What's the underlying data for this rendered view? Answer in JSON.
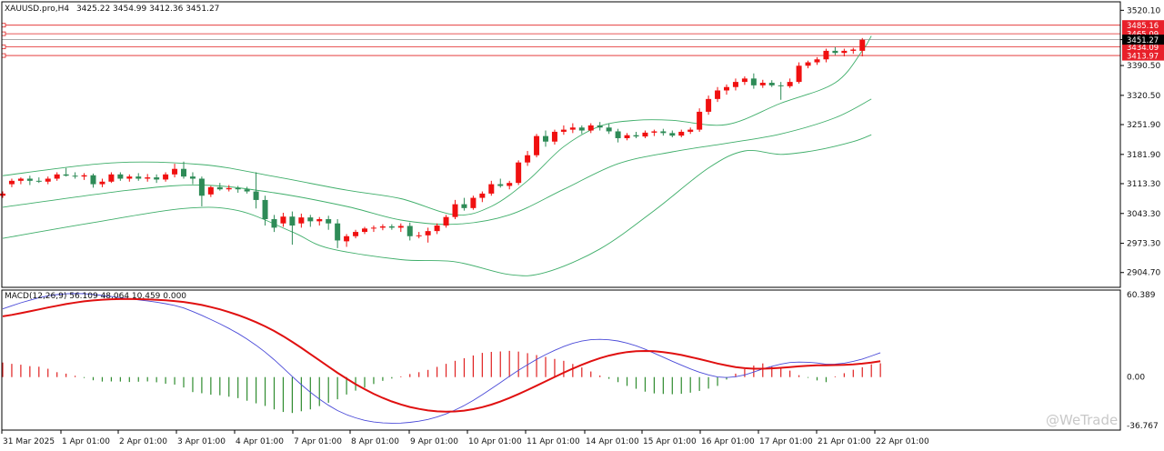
{
  "chart_data": {
    "type": "candlestick",
    "header": {
      "symbol_label": "XAUUSD.pro,H4",
      "ohlc": "3425.22 3454.99 3412.36 3451.27"
    },
    "price_axis": {
      "range": [
        2870,
        3540
      ],
      "ticks": [
        "3520.10",
        "3451.27",
        "3390.50",
        "3320.50",
        "3251.90",
        "3181.90",
        "3113.30",
        "3043.30",
        "2973.30",
        "2904.70"
      ]
    },
    "level_lines": [
      {
        "value": 3485.16,
        "label": "3485.16"
      },
      {
        "value": 3465.09,
        "label": "3465.09"
      },
      {
        "value": 3434.09,
        "label": "3434.09"
      },
      {
        "value": 3413.97,
        "label": "3413.97"
      }
    ],
    "current_price": {
      "value": 3451.27,
      "label": "3451.27"
    },
    "x_axis_labels": [
      "31 Mar 2025",
      "1 Apr 01:00",
      "2 Apr 01:00",
      "3 Apr 01:00",
      "4 Apr 01:00",
      "7 Apr 01:00",
      "8 Apr 01:00",
      "9 Apr 01:00",
      "10 Apr 01:00",
      "11 Apr 01:00",
      "14 Apr 01:00",
      "15 Apr 01:00",
      "16 Apr 01:00",
      "17 Apr 01:00",
      "21 Apr 01:00",
      "22 Apr 01:00"
    ],
    "candles": [
      {
        "o": 3085,
        "h": 3095,
        "l": 3080,
        "c": 3090
      },
      {
        "o": 3112,
        "h": 3125,
        "l": 3105,
        "c": 3120
      },
      {
        "o": 3120,
        "h": 3128,
        "l": 3112,
        "c": 3125
      },
      {
        "o": 3125,
        "h": 3132,
        "l": 3110,
        "c": 3120
      },
      {
        "o": 3120,
        "h": 3128,
        "l": 3115,
        "c": 3118
      },
      {
        "o": 3118,
        "h": 3130,
        "l": 3112,
        "c": 3125
      },
      {
        "o": 3125,
        "h": 3140,
        "l": 3120,
        "c": 3135
      },
      {
        "o": 3135,
        "h": 3150,
        "l": 3130,
        "c": 3132
      },
      {
        "o": 3132,
        "h": 3140,
        "l": 3125,
        "c": 3130
      },
      {
        "o": 3130,
        "h": 3138,
        "l": 3122,
        "c": 3133
      },
      {
        "o": 3133,
        "h": 3137,
        "l": 3104,
        "c": 3112
      },
      {
        "o": 3112,
        "h": 3125,
        "l": 3105,
        "c": 3118
      },
      {
        "o": 3118,
        "h": 3140,
        "l": 3115,
        "c": 3135
      },
      {
        "o": 3135,
        "h": 3140,
        "l": 3120,
        "c": 3125
      },
      {
        "o": 3125,
        "h": 3135,
        "l": 3118,
        "c": 3130
      },
      {
        "o": 3130,
        "h": 3138,
        "l": 3120,
        "c": 3125
      },
      {
        "o": 3125,
        "h": 3136,
        "l": 3118,
        "c": 3128
      },
      {
        "o": 3128,
        "h": 3135,
        "l": 3115,
        "c": 3123
      },
      {
        "o": 3123,
        "h": 3140,
        "l": 3118,
        "c": 3135
      },
      {
        "o": 3135,
        "h": 3160,
        "l": 3128,
        "c": 3148
      },
      {
        "o": 3148,
        "h": 3165,
        "l": 3125,
        "c": 3130
      },
      {
        "o": 3130,
        "h": 3140,
        "l": 3112,
        "c": 3125
      },
      {
        "o": 3125,
        "h": 3130,
        "l": 3060,
        "c": 3085
      },
      {
        "o": 3088,
        "h": 3108,
        "l": 3082,
        "c": 3105
      },
      {
        "o": 3105,
        "h": 3115,
        "l": 3097,
        "c": 3100
      },
      {
        "o": 3100,
        "h": 3110,
        "l": 3095,
        "c": 3103
      },
      {
        "o": 3103,
        "h": 3108,
        "l": 3092,
        "c": 3100
      },
      {
        "o": 3100,
        "h": 3106,
        "l": 3090,
        "c": 3095
      },
      {
        "o": 3095,
        "h": 3140,
        "l": 3055,
        "c": 3075
      },
      {
        "o": 3075,
        "h": 3085,
        "l": 3015,
        "c": 3030
      },
      {
        "o": 3030,
        "h": 3040,
        "l": 3000,
        "c": 3010
      },
      {
        "o": 3020,
        "h": 3045,
        "l": 3012,
        "c": 3036
      },
      {
        "o": 3036,
        "h": 3048,
        "l": 2970,
        "c": 3015
      },
      {
        "o": 3020,
        "h": 3043,
        "l": 3010,
        "c": 3034
      },
      {
        "o": 3034,
        "h": 3040,
        "l": 3012,
        "c": 3025
      },
      {
        "o": 3025,
        "h": 3035,
        "l": 3015,
        "c": 3030
      },
      {
        "o": 3030,
        "h": 3038,
        "l": 3005,
        "c": 3020
      },
      {
        "o": 3020,
        "h": 3030,
        "l": 2962,
        "c": 2980
      },
      {
        "o": 2978,
        "h": 2995,
        "l": 2965,
        "c": 2990
      },
      {
        "o": 2990,
        "h": 3005,
        "l": 2985,
        "c": 3000
      },
      {
        "o": 3000,
        "h": 3012,
        "l": 2995,
        "c": 3008
      },
      {
        "o": 3008,
        "h": 3015,
        "l": 3000,
        "c": 3010
      },
      {
        "o": 3010,
        "h": 3018,
        "l": 3004,
        "c": 3013
      },
      {
        "o": 3013,
        "h": 3018,
        "l": 3005,
        "c": 3010
      },
      {
        "o": 3010,
        "h": 3020,
        "l": 3000,
        "c": 3014
      },
      {
        "o": 3014,
        "h": 3022,
        "l": 2980,
        "c": 2990
      },
      {
        "o": 2990,
        "h": 3000,
        "l": 2985,
        "c": 2992
      },
      {
        "o": 2992,
        "h": 3010,
        "l": 2975,
        "c": 3002
      },
      {
        "o": 3002,
        "h": 3020,
        "l": 2995,
        "c": 3015
      },
      {
        "o": 3015,
        "h": 3040,
        "l": 3010,
        "c": 3035
      },
      {
        "o": 3035,
        "h": 3075,
        "l": 3030,
        "c": 3065
      },
      {
        "o": 3065,
        "h": 3080,
        "l": 3050,
        "c": 3056
      },
      {
        "o": 3056,
        "h": 3085,
        "l": 3052,
        "c": 3080
      },
      {
        "o": 3080,
        "h": 3095,
        "l": 3070,
        "c": 3090
      },
      {
        "o": 3090,
        "h": 3120,
        "l": 3085,
        "c": 3112
      },
      {
        "o": 3112,
        "h": 3125,
        "l": 3104,
        "c": 3108
      },
      {
        "o": 3108,
        "h": 3120,
        "l": 3100,
        "c": 3115
      },
      {
        "o": 3115,
        "h": 3168,
        "l": 3110,
        "c": 3163
      },
      {
        "o": 3163,
        "h": 3190,
        "l": 3155,
        "c": 3180
      },
      {
        "o": 3180,
        "h": 3230,
        "l": 3175,
        "c": 3225
      },
      {
        "o": 3225,
        "h": 3238,
        "l": 3200,
        "c": 3212
      },
      {
        "o": 3212,
        "h": 3240,
        "l": 3205,
        "c": 3235
      },
      {
        "o": 3235,
        "h": 3250,
        "l": 3228,
        "c": 3240
      },
      {
        "o": 3240,
        "h": 3255,
        "l": 3232,
        "c": 3245
      },
      {
        "o": 3245,
        "h": 3250,
        "l": 3230,
        "c": 3238
      },
      {
        "o": 3238,
        "h": 3255,
        "l": 3232,
        "c": 3250
      },
      {
        "o": 3250,
        "h": 3258,
        "l": 3238,
        "c": 3245
      },
      {
        "o": 3245,
        "h": 3255,
        "l": 3230,
        "c": 3236
      },
      {
        "o": 3236,
        "h": 3242,
        "l": 3210,
        "c": 3220
      },
      {
        "o": 3220,
        "h": 3232,
        "l": 3215,
        "c": 3227
      },
      {
        "o": 3227,
        "h": 3235,
        "l": 3220,
        "c": 3224
      },
      {
        "o": 3224,
        "h": 3238,
        "l": 3220,
        "c": 3233
      },
      {
        "o": 3233,
        "h": 3240,
        "l": 3225,
        "c": 3236
      },
      {
        "o": 3236,
        "h": 3242,
        "l": 3226,
        "c": 3232
      },
      {
        "o": 3232,
        "h": 3238,
        "l": 3222,
        "c": 3226
      },
      {
        "o": 3226,
        "h": 3240,
        "l": 3222,
        "c": 3235
      },
      {
        "o": 3235,
        "h": 3245,
        "l": 3230,
        "c": 3240
      },
      {
        "o": 3240,
        "h": 3290,
        "l": 3235,
        "c": 3282
      },
      {
        "o": 3282,
        "h": 3320,
        "l": 3275,
        "c": 3312
      },
      {
        "o": 3312,
        "h": 3340,
        "l": 3305,
        "c": 3332
      },
      {
        "o": 3332,
        "h": 3346,
        "l": 3322,
        "c": 3340
      },
      {
        "o": 3340,
        "h": 3360,
        "l": 3332,
        "c": 3352
      },
      {
        "o": 3352,
        "h": 3365,
        "l": 3345,
        "c": 3360
      },
      {
        "o": 3360,
        "h": 3372,
        "l": 3336,
        "c": 3344
      },
      {
        "o": 3344,
        "h": 3357,
        "l": 3338,
        "c": 3350
      },
      {
        "o": 3350,
        "h": 3356,
        "l": 3340,
        "c": 3344
      },
      {
        "o": 3344,
        "h": 3352,
        "l": 3310,
        "c": 3342
      },
      {
        "o": 3342,
        "h": 3360,
        "l": 3338,
        "c": 3352
      },
      {
        "o": 3352,
        "h": 3398,
        "l": 3348,
        "c": 3390
      },
      {
        "o": 3390,
        "h": 3402,
        "l": 3384,
        "c": 3398
      },
      {
        "o": 3398,
        "h": 3410,
        "l": 3392,
        "c": 3405
      },
      {
        "o": 3405,
        "h": 3430,
        "l": 3398,
        "c": 3425
      },
      {
        "o": 3425,
        "h": 3434,
        "l": 3415,
        "c": 3420
      },
      {
        "o": 3420,
        "h": 3430,
        "l": 3412,
        "c": 3425
      },
      {
        "o": 3425,
        "h": 3432,
        "l": 3418,
        "c": 3428
      },
      {
        "o": 3425,
        "h": 3455,
        "l": 3412,
        "c": 3451
      }
    ],
    "bollinger_bands": {
      "upper": [
        [
          0,
          3132
        ],
        [
          12,
          3162
        ],
        [
          22,
          3158
        ],
        [
          30,
          3130
        ],
        [
          38,
          3098
        ],
        [
          44,
          3078
        ],
        [
          50,
          3040
        ],
        [
          54,
          3060
        ],
        [
          58,
          3120
        ],
        [
          62,
          3200
        ],
        [
          66,
          3248
        ],
        [
          70,
          3262
        ],
        [
          74,
          3262
        ],
        [
          80,
          3252
        ],
        [
          86,
          3302
        ],
        [
          92,
          3350
        ],
        [
          95,
          3425
        ],
        [
          96,
          3460
        ]
      ],
      "middle": [
        [
          0,
          3058
        ],
        [
          14,
          3098
        ],
        [
          22,
          3110
        ],
        [
          30,
          3092
        ],
        [
          38,
          3060
        ],
        [
          44,
          3028
        ],
        [
          50,
          3018
        ],
        [
          56,
          3040
        ],
        [
          62,
          3100
        ],
        [
          68,
          3160
        ],
        [
          74,
          3188
        ],
        [
          80,
          3208
        ],
        [
          86,
          3230
        ],
        [
          92,
          3268
        ],
        [
          96,
          3312
        ]
      ],
      "lower": [
        [
          0,
          2985
        ],
        [
          10,
          3022
        ],
        [
          20,
          3055
        ],
        [
          26,
          3050
        ],
        [
          32,
          3000
        ],
        [
          36,
          2962
        ],
        [
          44,
          2935
        ],
        [
          50,
          2930
        ],
        [
          56,
          2900
        ],
        [
          60,
          2905
        ],
        [
          66,
          2960
        ],
        [
          72,
          3050
        ],
        [
          78,
          3150
        ],
        [
          82,
          3190
        ],
        [
          86,
          3182
        ],
        [
          90,
          3192
        ],
        [
          94,
          3212
        ],
        [
          96,
          3228
        ]
      ]
    },
    "macd": {
      "header": "MACD(12,26,9) 56.109 48.064 10.459 0.000",
      "range": [
        -36.767,
        60.389
      ],
      "ticks": [
        "60.389",
        "0.00"
      ],
      "histogram": [
        10.1,
        9.2,
        8.6,
        7.6,
        7.2,
        5.8,
        3.4,
        2.4,
        0.9,
        -0.6,
        -2.2,
        -3.1,
        -3.0,
        -3.1,
        -3.4,
        -3.2,
        -3.0,
        -3.6,
        -4.6,
        -5.2,
        -7.2,
        -10.4,
        -11.2,
        -12.2,
        -12.6,
        -13.6,
        -14.6,
        -16.4,
        -18.2,
        -20.0,
        -22.4,
        -24.2,
        -24.9,
        -23.7,
        -22.4,
        -20.1,
        -17.8,
        -15.4,
        -12.1,
        -9.4,
        -7.3,
        -4.8,
        -2.6,
        -1.0,
        0.5,
        2.1,
        3.4,
        5.0,
        7.1,
        9.2,
        11.3,
        13.1,
        15.0,
        16.8,
        17.5,
        17.8,
        18.2,
        17.7,
        16.6,
        15.3,
        14.0,
        12.6,
        11.3,
        9.1,
        6.7,
        3.9,
        1.1,
        -1.2,
        -3.5,
        -6.1,
        -8.1,
        -10.1,
        -11.3,
        -11.7,
        -11.9,
        -11.6,
        -10.8,
        -9.6,
        -8.0,
        -6.1,
        -1.7,
        2.4,
        5.5,
        8.0,
        9.5,
        7.4,
        6.7,
        4.5,
        1.3,
        -0.5,
        -2.3,
        -3.5,
        0.5,
        2.7,
        5.1,
        6.8,
        8.9,
        9.6
      ]
    },
    "watermark": "@WeTrade"
  }
}
